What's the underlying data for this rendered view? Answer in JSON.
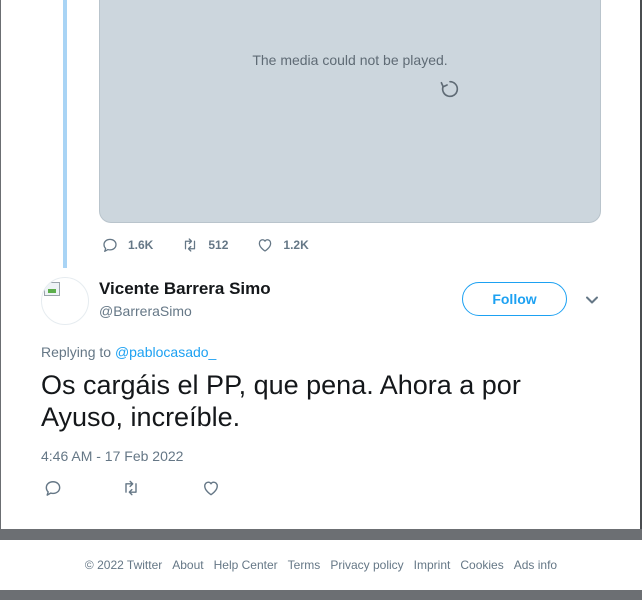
{
  "quoted_tweet": {
    "media_error": "The media could not be played.",
    "reply_count": "1.6K",
    "retweet_count": "512",
    "like_count": "1.2K"
  },
  "tweet": {
    "display_name": "Vicente Barrera Simo",
    "handle": "@BarreraSimo",
    "follow_label": "Follow",
    "replying_prefix": "Replying to",
    "replying_to": "@pablocasado_",
    "text": "Os cargáis el PP, que pena. Ahora a por Ayuso, increíble.",
    "timestamp": "4:46 AM - 17 Feb 2022"
  },
  "footer": {
    "copyright": "© 2022 Twitter",
    "links": [
      "About",
      "Help Center",
      "Terms",
      "Privacy policy",
      "Imprint",
      "Cookies",
      "Ads info"
    ]
  },
  "colors": {
    "accent": "#1da1f2",
    "thread_line": "#a9d4f5",
    "media_bg": "#ccd6dd",
    "muted_text": "#657786"
  },
  "icons": [
    "retry-icon",
    "reply-icon",
    "retweet-icon",
    "like-icon",
    "chevron-down-icon"
  ]
}
